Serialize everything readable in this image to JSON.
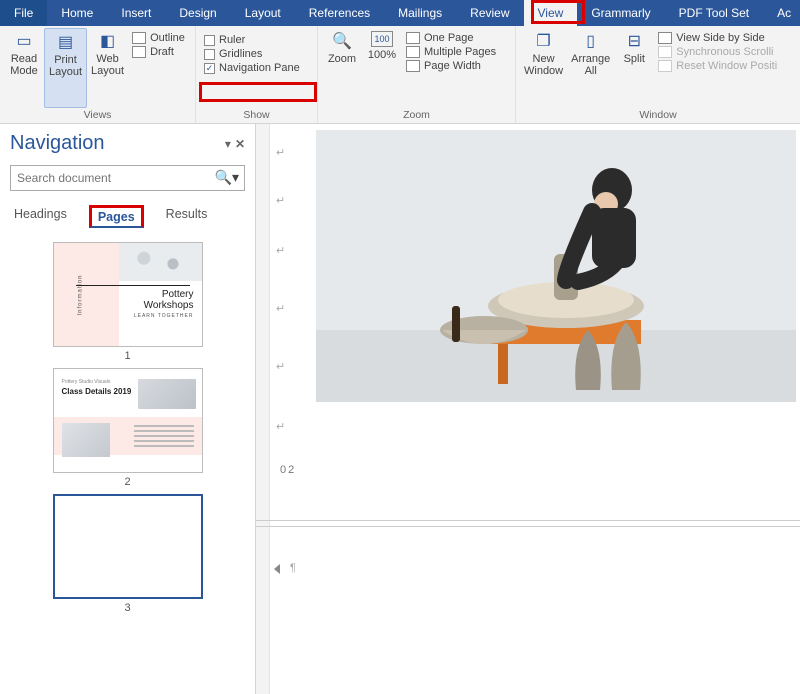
{
  "tabs": {
    "file": "File",
    "home": "Home",
    "insert": "Insert",
    "design": "Design",
    "layout": "Layout",
    "references": "References",
    "mailings": "Mailings",
    "review": "Review",
    "view": "View",
    "grammarly": "Grammarly",
    "pdftoolset": "PDF Tool Set",
    "acrobat_partial": "Ac"
  },
  "ribbon": {
    "views": {
      "read_mode": "Read\nMode",
      "print_layout": "Print\nLayout",
      "web_layout": "Web\nLayout",
      "outline": "Outline",
      "draft": "Draft",
      "group_label": "Views"
    },
    "show": {
      "ruler": "Ruler",
      "gridlines": "Gridlines",
      "navigation_pane": "Navigation Pane",
      "group_label": "Show"
    },
    "zoom": {
      "zoom": "Zoom",
      "hundred": "100%",
      "one_page": "One Page",
      "multiple_pages": "Multiple Pages",
      "page_width": "Page Width",
      "group_label": "Zoom"
    },
    "window": {
      "new_window": "New\nWindow",
      "arrange_all": "Arrange\nAll",
      "split": "Split",
      "view_side_by_side": "View Side by Side",
      "synchronous_scrolling": "Synchronous Scrolli",
      "reset_window_position": "Reset Window Positi",
      "group_label": "Window"
    }
  },
  "nav": {
    "title": "Navigation",
    "search_placeholder": "Search document",
    "tabs": {
      "headings": "Headings",
      "pages": "Pages",
      "results": "Results"
    },
    "thumbs": {
      "p1": {
        "num": "1",
        "sidelabel": "Information",
        "title_line1": "Pottery",
        "title_line2": "Workshops",
        "subtitle": "LEARN TOGETHER"
      },
      "p2": {
        "num": "2",
        "kicker": "Pottery Studio Visuals",
        "title": "Class Details 2019"
      },
      "p3": {
        "num": "3"
      }
    }
  },
  "doc": {
    "page_number_label": "02"
  }
}
